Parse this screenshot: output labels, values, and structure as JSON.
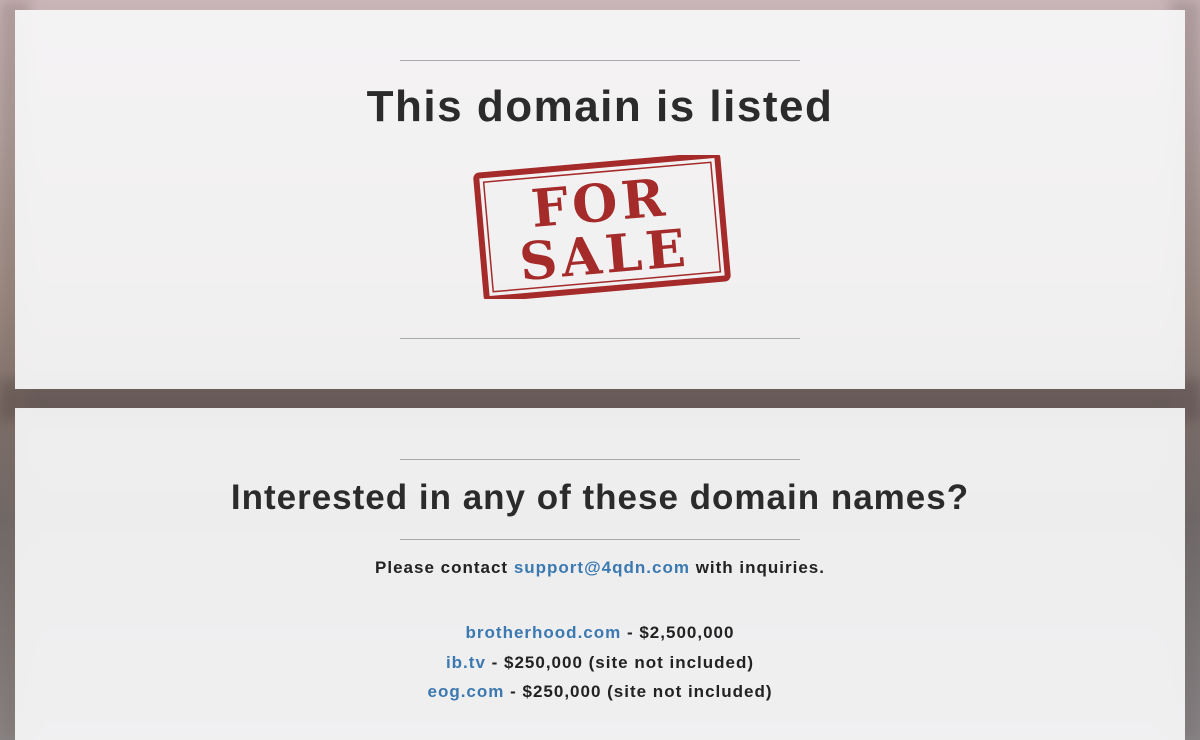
{
  "hero": {
    "title": "This domain is listed",
    "stamp_line1": "FOR",
    "stamp_line2": "SALE"
  },
  "listing": {
    "heading": "Interested in any of these domain names?",
    "contact_prefix": "Please contact",
    "contact_email": "support@4qdn.com",
    "contact_suffix": "with inquiries.",
    "domains": [
      {
        "name": "brotherhood.com",
        "detail": " - $2,500,000"
      },
      {
        "name": "ib.tv",
        "detail": " - $250,000 (site not included)"
      },
      {
        "name": "eog.com",
        "detail": " - $250,000 (site not included)"
      }
    ]
  },
  "colors": {
    "link": "#3b79b0",
    "stamp": "#a52a2a",
    "text": "#2b2b2b"
  }
}
